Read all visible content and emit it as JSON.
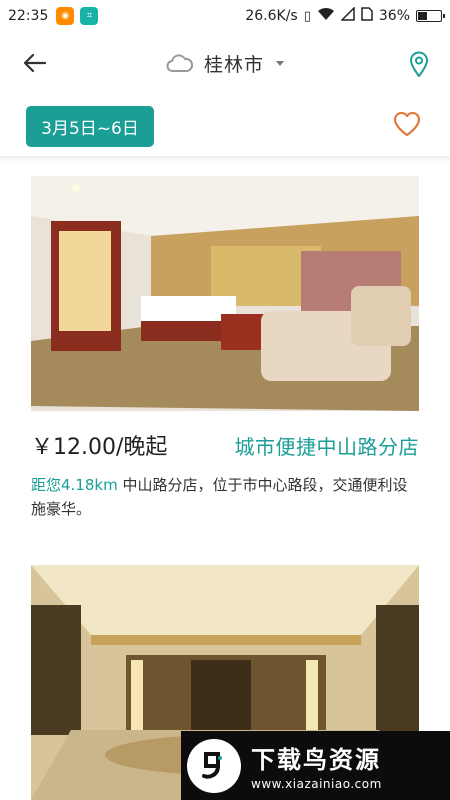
{
  "status_bar": {
    "time": "22:35",
    "network_speed": "26.6K/s",
    "battery": "36%",
    "battery_level": 0.36,
    "icons": [
      "vibrate-icon",
      "wifi-icon",
      "signal-icon",
      "sim-icon",
      "battery-icon"
    ]
  },
  "header": {
    "city": "桂林市",
    "back_icon": "arrow-left-icon",
    "weather_icon": "cloud-icon",
    "location_icon": "map-pin-icon"
  },
  "filters": {
    "date_range": "3月5日~6日",
    "favorite_icon": "heart-icon"
  },
  "hotels": [
    {
      "price": "￥12.00/晚起",
      "name": "城市便捷中山路分店",
      "distance": "距您4.18km",
      "description": " 中山路分店，位于市中心路段，交通便利设施豪华。"
    },
    {
      "price": "",
      "name": "",
      "distance": "",
      "description": ""
    }
  ],
  "watermark": {
    "title": "下载鸟资源",
    "url": "www.xiazainiao.com"
  },
  "colors": {
    "accent": "#1a9e96",
    "heart": "#e07a3a"
  }
}
